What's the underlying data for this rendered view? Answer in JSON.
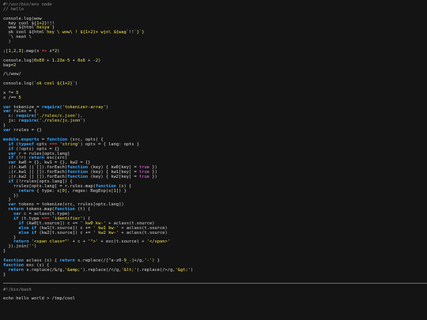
{
  "editor": {
    "section1": [
      "#!/usr/bin/env node",
      "// hello",
      "",
      "console.log(wow",
      "  hey cool ${1+2}!!!",
      "  wow ${html`heiya`}",
      "  ok cool ${html`hey \\ wow\\ ! ${1+2}+ wjo\\ ${wag`!!`}`}",
      "  `\\ neat \\",
      "  )",
      "",
      ";[1,2,3].map(x => x*2)",
      "",
      "console.log(0xE0 + 1.23e-5 + 0o6 + -2)",
      "bap=2",
      "",
      "/\\/wow/",
      "",
      "console.log(`ok cool ${1+2}`)",
      "",
      "x *= 5",
      "x /== 5",
      "",
      "var tokenize = require('tokenizer-array')",
      "var rules = {",
      "  c: require('./rules/c.json'),",
      "  js: require('./rules/js.json')",
      "}",
      "var rrules = {}",
      "",
      "module.exports = function (src, opts) {",
      "  if (typeof opts === 'string') opts = { lang: opts }",
      "  if (!opts) opts = {}",
      "  var r = rules[opts.lang]",
      "  if (!r) return esc(src)",
      "  var kw0 = {}, kw1 = {}, kw2 = {}",
      "  ;(r.kw0 || []).forEach(function (key) { kw0[key] = true })",
      "  ;(r.kw1 || []).forEach(function (key) { kw1[key] = true })",
      "  ;(r.kw2 || []).forEach(function (key) { kw2[key] = true })",
      "  if (!rrules[opts.lang]) {",
      "    rrules[opts.lang] = r.rules.map(function (s) {",
      "      return { type: s[0], regex: RegExp(s[1]) }",
      "    })",
      "  }",
      "  var tokens = tokenize(src, rrules[opts.lang])",
      "  return tokens.map(function (t) {",
      "    var c = aclass(t.type)",
      "    if (t.type === 'identifier') {",
      "      if (kw0[t.source]) c += ' kw0 kw-' + aclass(t.source)",
      "      else if (kw1[t.source]) c += ' kw1 kw-' + aclass(t.source)",
      "      else if (kw2[t.source]) c += ' kw2 kw-' + aclass(t.source)",
      "    }",
      "    return '<span class=\"' + c + '\">' + esc(t.source) + '</span>'",
      "  }).join('')",
      "}",
      "",
      "function aclass (s) { return s.replace(/[^a-z0-9_-]+/g,'-') }",
      "function esc (s) {",
      "  return s.replace(/&/g,'&amp;').replace(/</g,'&lt;').replace(/>/g,'&gt;')",
      "}"
    ],
    "section2": [
      "#!/bin/bash",
      "",
      "echo hello world > /tmp/cool"
    ]
  }
}
